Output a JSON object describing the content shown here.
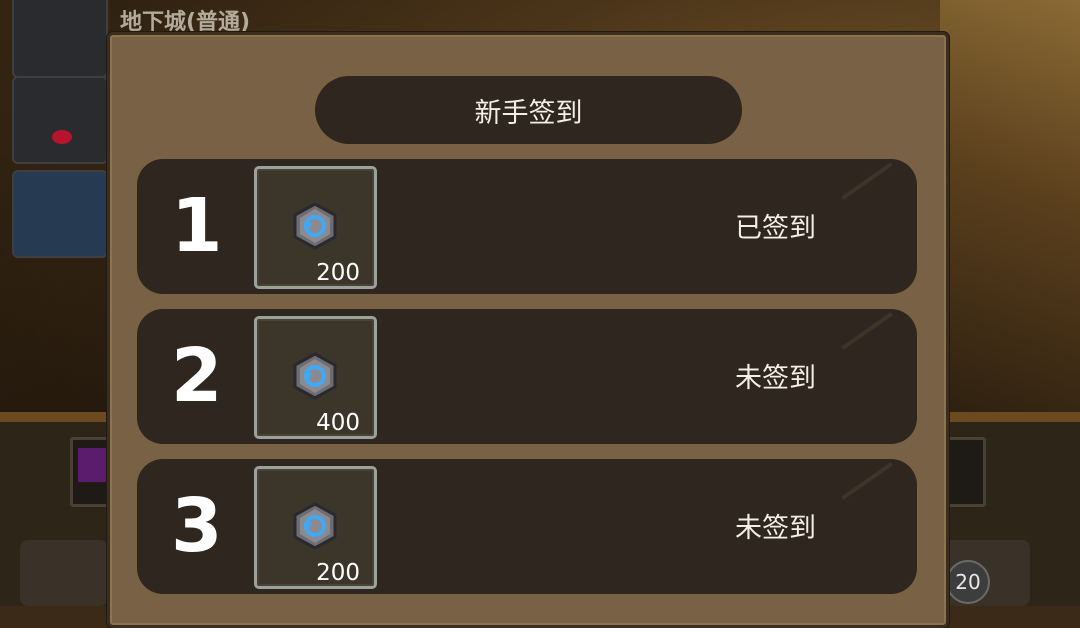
{
  "background": {
    "dungeon_title": "地下城(普通)",
    "currency_value": "20"
  },
  "dialog": {
    "title": "新手签到",
    "rows": [
      {
        "day": "1",
        "reward_icon": "rune-stone-icon",
        "reward_qty": "200",
        "status": "已签到"
      },
      {
        "day": "2",
        "reward_icon": "rune-stone-icon",
        "reward_qty": "400",
        "status": "未签到"
      },
      {
        "day": "3",
        "reward_icon": "rune-stone-icon",
        "reward_qty": "200",
        "status": "未签到"
      }
    ]
  },
  "colors": {
    "panel": "#786144",
    "row_bg": "#2e261f",
    "text": "#f3efe7",
    "gem_blue": "#3fa9f5"
  }
}
